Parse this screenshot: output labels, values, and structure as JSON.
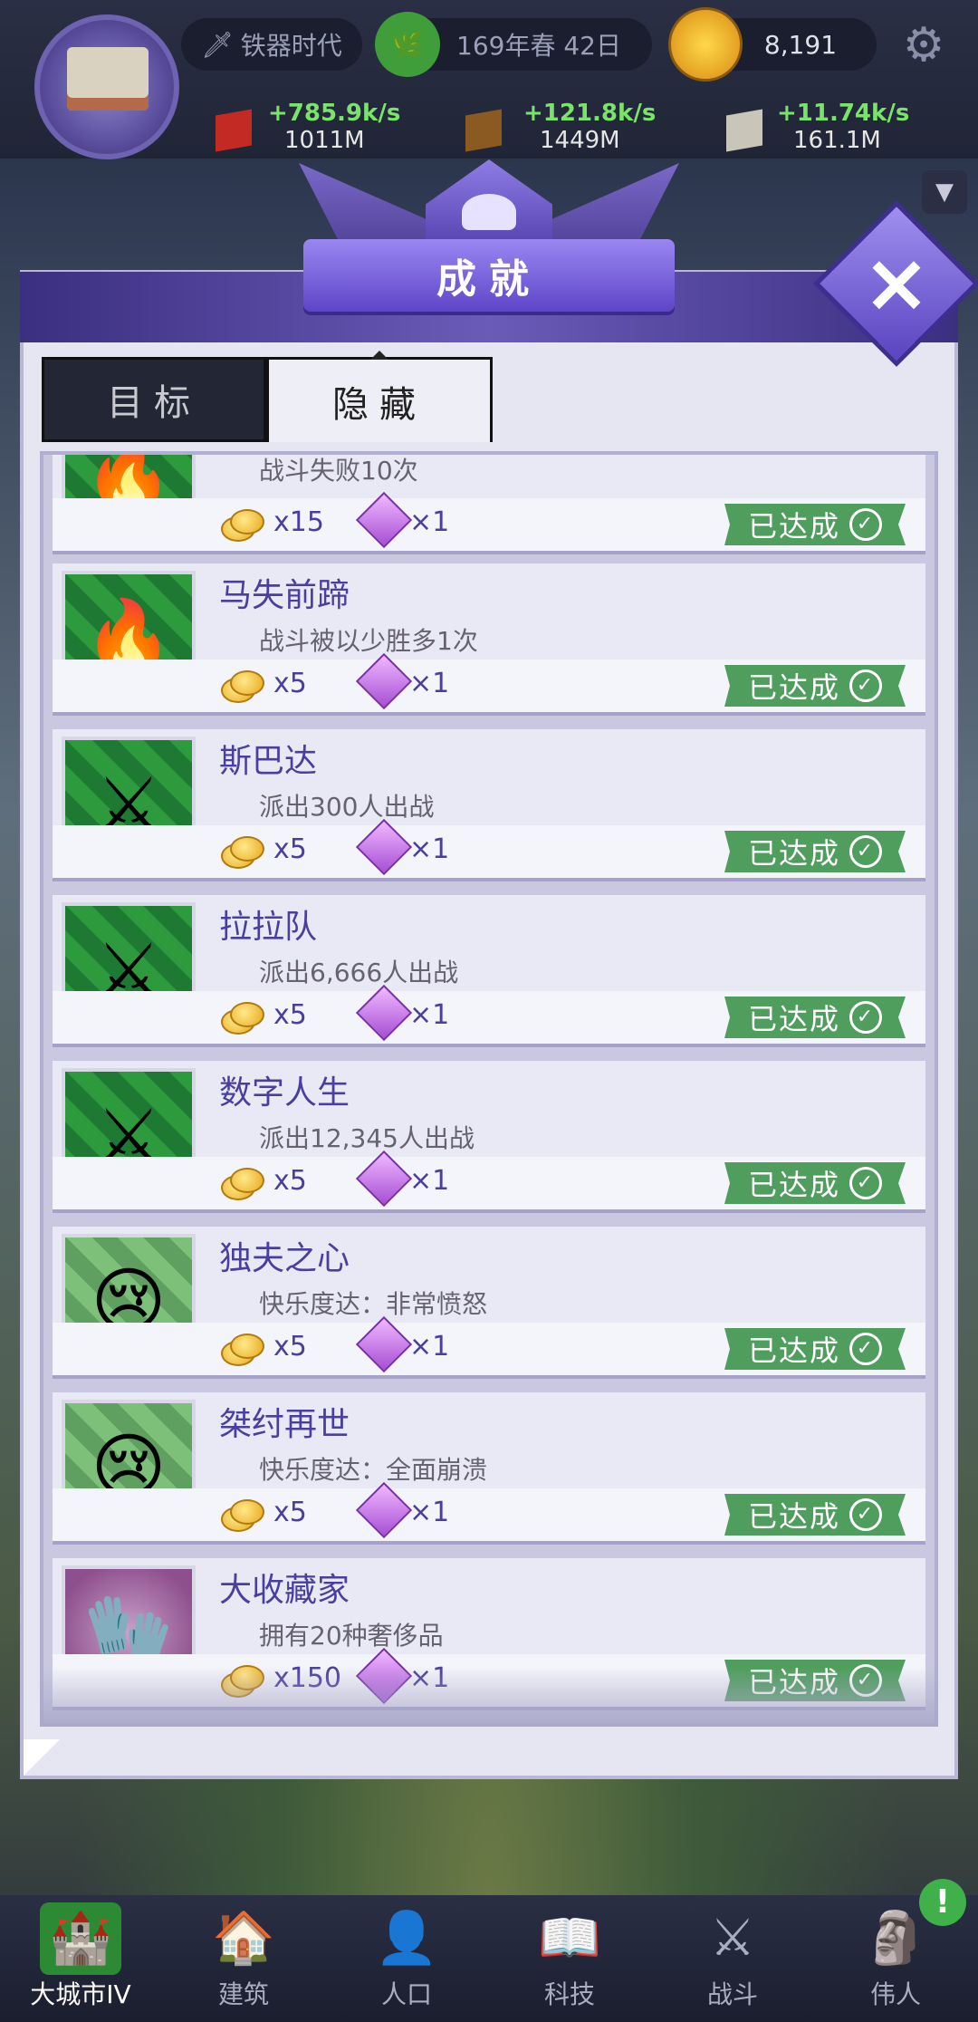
{
  "topbar": {
    "era": "铁器时代",
    "date": "169年春 42日",
    "gold": "8,191",
    "resources": [
      {
        "rate": "+785.9k/s",
        "amount": "1011M",
        "color": "#d0302a"
      },
      {
        "rate": "+121.8k/s",
        "amount": "1449M",
        "color": "#8a5a22"
      },
      {
        "rate": "+11.74k/s",
        "amount": "161.1M",
        "color": "#c9c5b8"
      }
    ]
  },
  "dialog": {
    "title": "成就",
    "close": "×",
    "tabs": [
      {
        "label": "目标"
      },
      {
        "label": "隐藏"
      }
    ]
  },
  "achievements": [
    {
      "title": "",
      "desc": "战斗失败10次",
      "coin": "x15",
      "gem": "×1",
      "status": "已达成",
      "icon": "spear-icon",
      "style": "green"
    },
    {
      "title": "马失前蹄",
      "desc": "战斗被以少胜多1次",
      "coin": "x5",
      "gem": "×1",
      "status": "已达成",
      "icon": "spear-icon",
      "style": "green"
    },
    {
      "title": "斯巴达",
      "desc": "派出300人出战",
      "coin": "x5",
      "gem": "×1",
      "status": "已达成",
      "icon": "sword-icon",
      "style": "green"
    },
    {
      "title": "拉拉队",
      "desc": "派出6,666人出战",
      "coin": "x5",
      "gem": "×1",
      "status": "已达成",
      "icon": "sword-icon",
      "style": "green"
    },
    {
      "title": "数字人生",
      "desc": "派出12,345人出战",
      "coin": "x5",
      "gem": "×1",
      "status": "已达成",
      "icon": "sword-icon",
      "style": "green"
    },
    {
      "title": "独夫之心",
      "desc": "快乐度达：非常愤怒",
      "coin": "x5",
      "gem": "×1",
      "status": "已达成",
      "icon": "crying-face-icon",
      "style": "stripe"
    },
    {
      "title": "桀纣再世",
      "desc": "快乐度达：全面崩溃",
      "coin": "x5",
      "gem": "×1",
      "status": "已达成",
      "icon": "crying-face-icon",
      "style": "stripe"
    },
    {
      "title": "大收藏家",
      "desc": "拥有20种奢侈品",
      "coin": "x150",
      "gem": "×1",
      "status": "已达成",
      "icon": "gauntlet-icon",
      "style": "purple"
    }
  ],
  "nav": [
    {
      "label": "大城市IV",
      "icon": "castle-icon",
      "active": true
    },
    {
      "label": "建筑",
      "icon": "house-icon"
    },
    {
      "label": "人口",
      "icon": "person-icon"
    },
    {
      "label": "科技",
      "icon": "book-icon"
    },
    {
      "label": "战斗",
      "icon": "crossed-swords-icon"
    },
    {
      "label": "伟人",
      "icon": "statue-icon"
    }
  ],
  "nav_alert": "!"
}
